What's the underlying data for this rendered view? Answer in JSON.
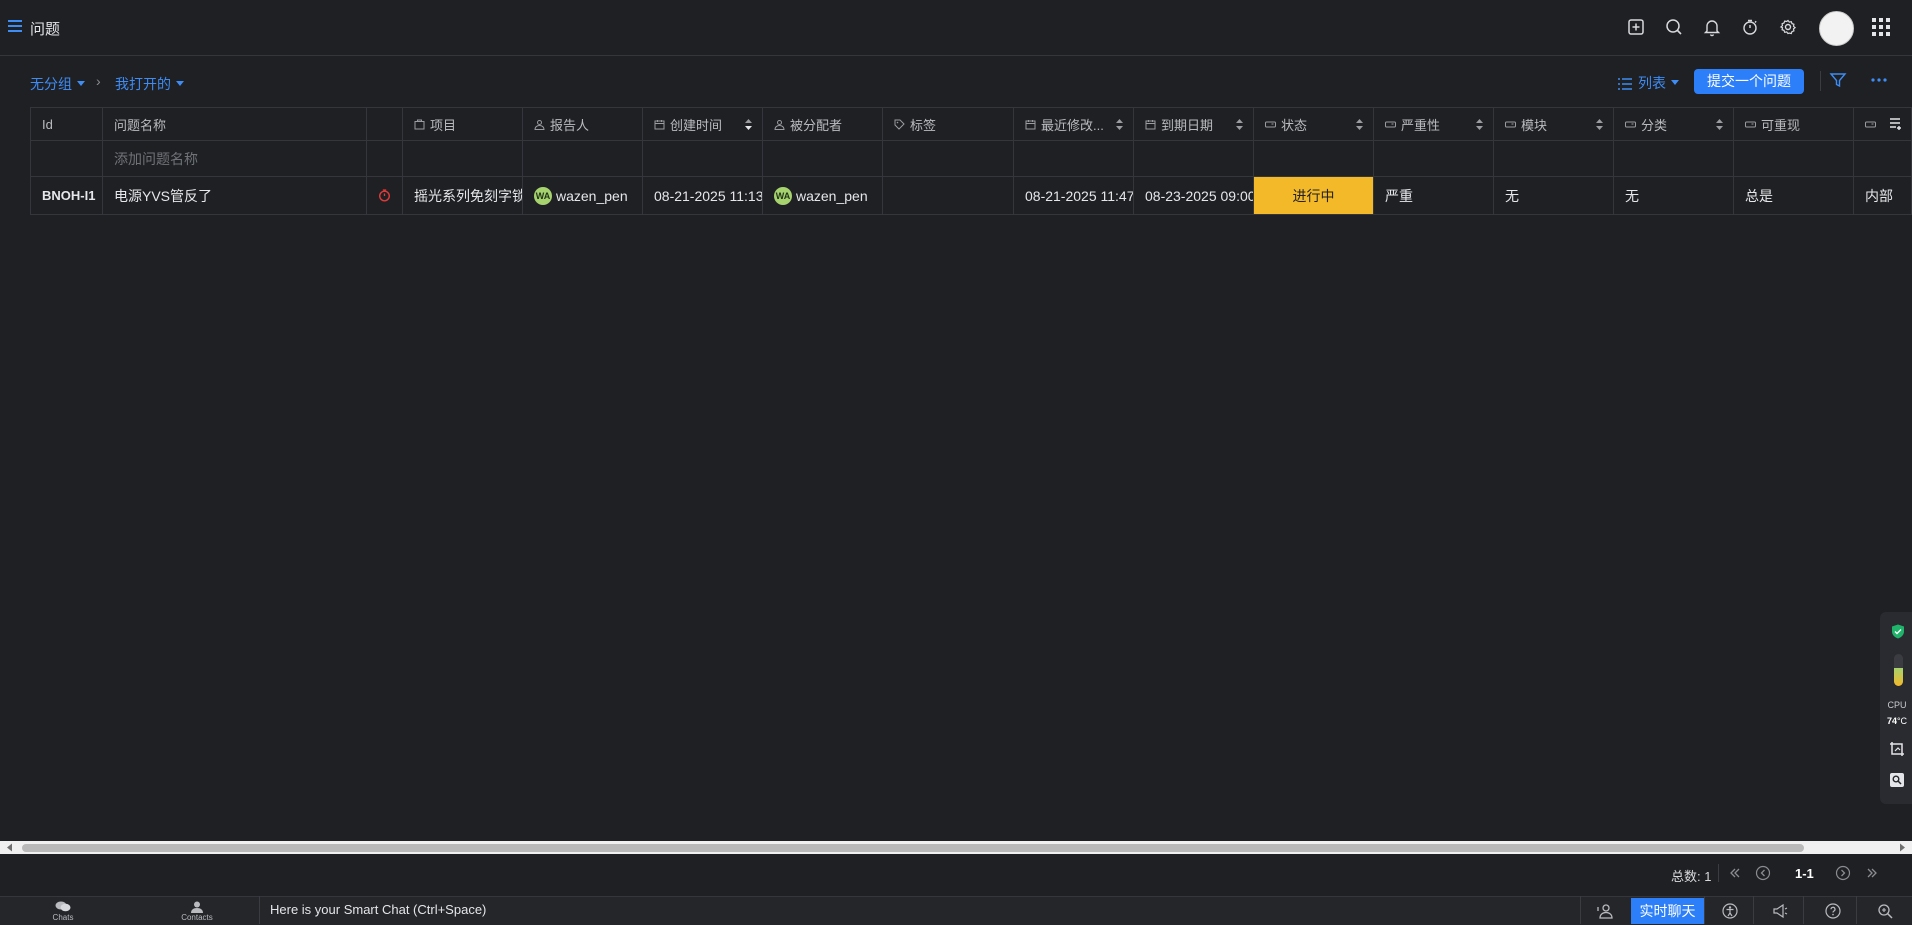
{
  "app": {
    "title": "问题"
  },
  "toolbar": {
    "group_label": "无分组",
    "filter_label": "我打开的",
    "view_label": "列表",
    "submit_label": "提交一个问题"
  },
  "table": {
    "headers": [
      "Id",
      "问题名称",
      "",
      "项目",
      "报告人",
      "创建时间",
      "被分配者",
      "标签",
      "最近修改...",
      "到期日期",
      "状态",
      "严重性",
      "模块",
      "分类",
      "可重现",
      ""
    ],
    "add_placeholder": "添加问题名称",
    "rows": [
      {
        "id": "BNOH-I1",
        "name": "电源YVS管反了",
        "project": "摇光系列免刻字锁",
        "reporter": "wazen_pen",
        "reporter_initials": "WA",
        "created": "08-21-2025 11:13",
        "assignee": "wazen_pen",
        "assignee_initials": "WA",
        "tags": "",
        "modified": "08-21-2025 11:47",
        "due": "08-23-2025 09:00",
        "status": "进行中",
        "severity": "严重",
        "module": "无",
        "category": "无",
        "reproducible": "总是",
        "extra": "内部"
      }
    ]
  },
  "widget": {
    "cpu_label": "CPU",
    "temp": "74",
    "temp_unit": "°C",
    "level": 0.55
  },
  "pagination": {
    "total_label": "总数: 1",
    "range": "1-1"
  },
  "bottombar": {
    "chats_label": "Chats",
    "contacts_label": "Contacts",
    "smart_chat": "Here is your Smart Chat (Ctrl+Space)",
    "live_chat": "实时聊天"
  },
  "colors": {
    "accent": "#2d7ff9",
    "status_in_progress": "#f4b929",
    "avatar_badge": "#a6d36e",
    "overdue": "#e03b3b"
  }
}
